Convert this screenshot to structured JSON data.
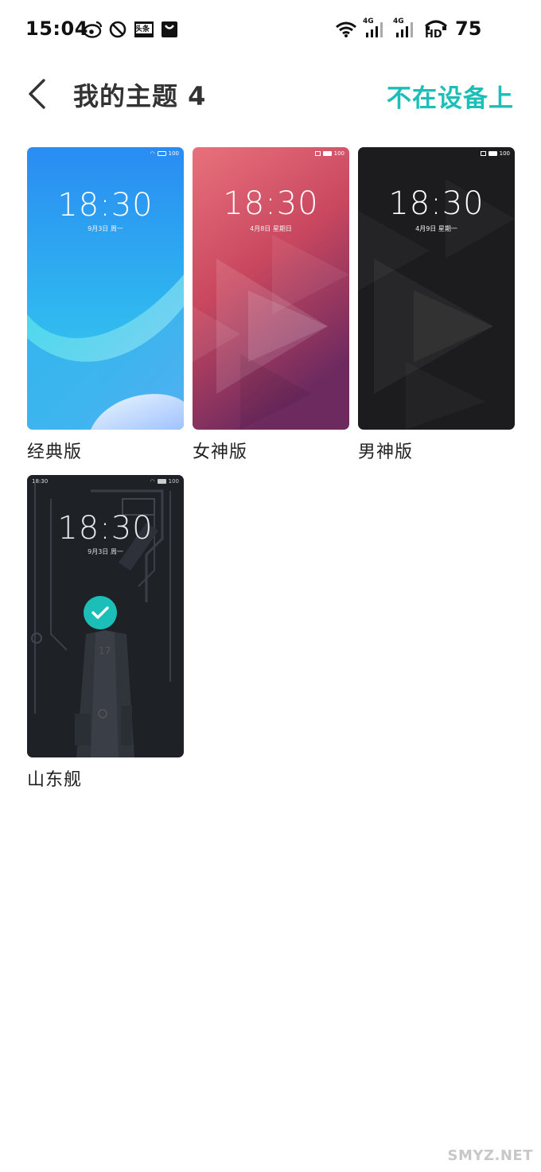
{
  "status_bar": {
    "time": "15:04",
    "battery": "75",
    "network_label_1": "4G",
    "network_label_2": "4G",
    "hd_label": "HD",
    "toutiao_label": "头条",
    "icons": [
      "weibo-icon",
      "do-not-disturb-icon",
      "toutiao-icon",
      "shopping-bag-icon",
      "wifi-icon",
      "signal-4g-icon",
      "signal-4g-icon",
      "hd-voice-icon"
    ]
  },
  "header": {
    "title": "我的主题 4",
    "action": "不在设备上",
    "accent_color": "#1bbfb8"
  },
  "themes": [
    {
      "name": "经典版",
      "lock_time": "18:30",
      "lock_date": "9月3日 周一",
      "battery": "100",
      "selected": false
    },
    {
      "name": "女神版",
      "lock_time": "18:30",
      "lock_date": "4月8日 星期日",
      "battery": "100",
      "selected": false
    },
    {
      "name": "男神版",
      "lock_time": "18:30",
      "lock_date": "4月9日 星期一",
      "battery": "100",
      "selected": false
    },
    {
      "name": "山东舰",
      "lock_time": "18:30",
      "lock_date": "9月3日 周一",
      "battery": "100",
      "status_time": "18:30",
      "hull_number": "17",
      "selected": true
    }
  ],
  "watermark": "SMYZ.NET"
}
